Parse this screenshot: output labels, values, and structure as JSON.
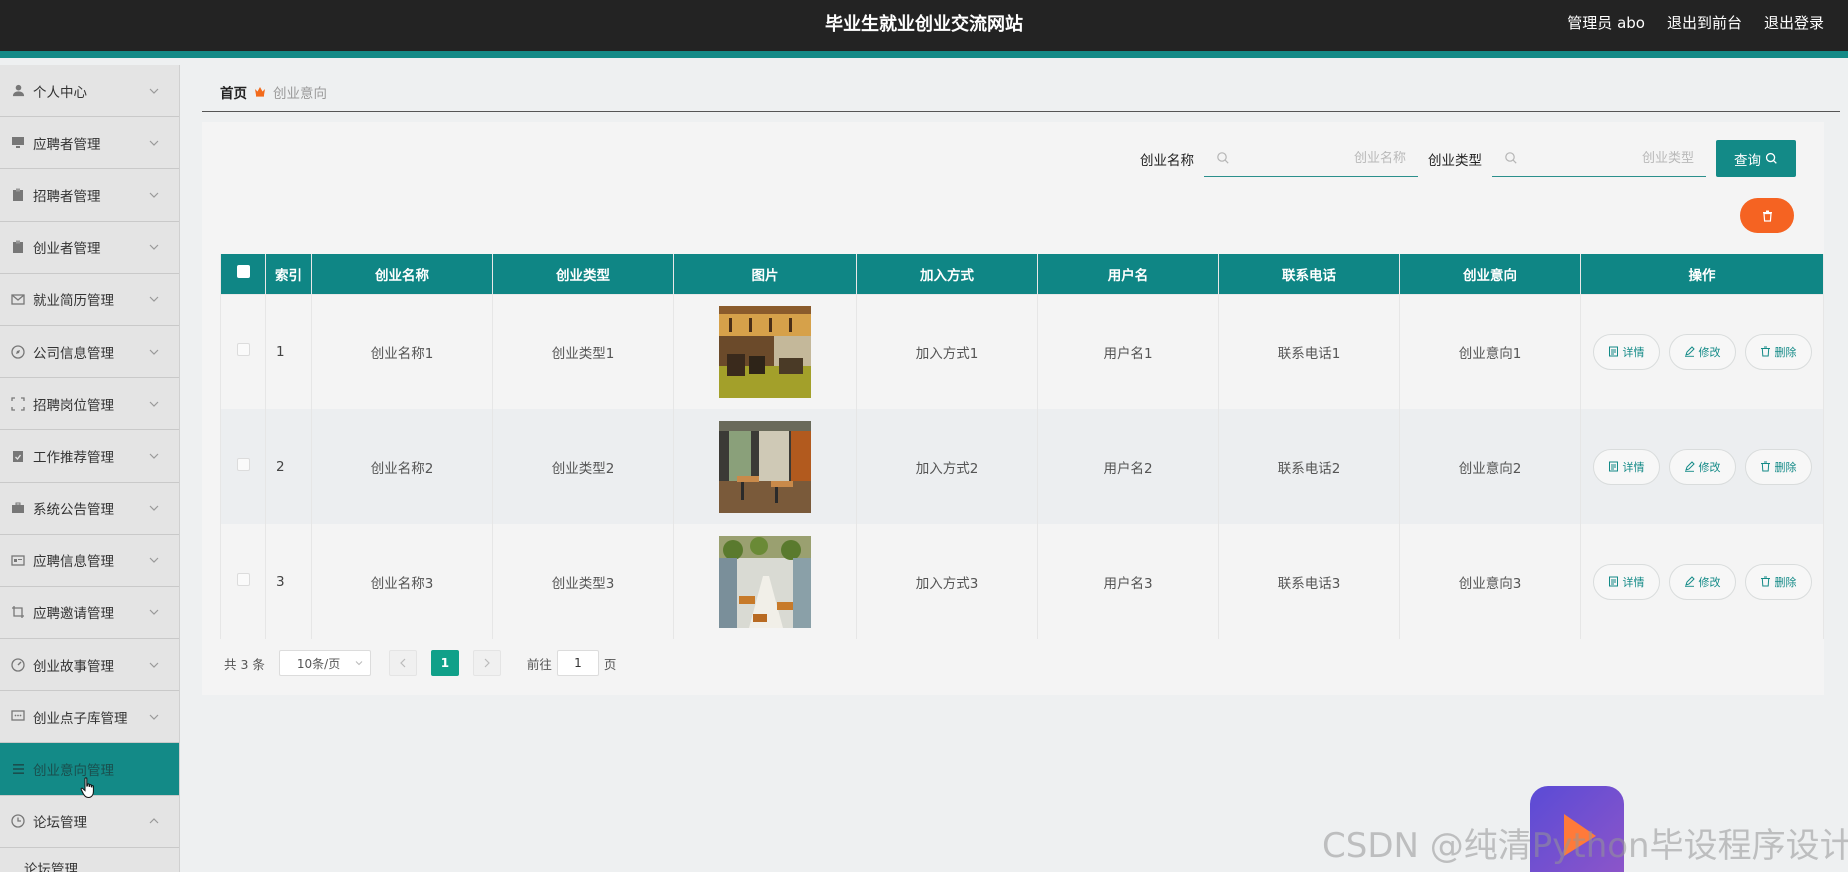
{
  "header": {
    "title": "毕业生就业创业交流网站",
    "admin": "管理员 abo",
    "to_front": "退出到前台",
    "logout": "退出登录"
  },
  "sidebar": {
    "items": [
      {
        "label": "个人中心",
        "icon": "user-icon"
      },
      {
        "label": "应聘者管理",
        "icon": "monitor-icon"
      },
      {
        "label": "招聘者管理",
        "icon": "clipboard-icon"
      },
      {
        "label": "创业者管理",
        "icon": "clipboard-icon"
      },
      {
        "label": "就业简历管理",
        "icon": "mail-icon"
      },
      {
        "label": "公司信息管理",
        "icon": "compass-icon"
      },
      {
        "label": "招聘岗位管理",
        "icon": "scan-icon"
      },
      {
        "label": "工作推荐管理",
        "icon": "checklist-icon"
      },
      {
        "label": "系统公告管理",
        "icon": "briefcase-icon"
      },
      {
        "label": "应聘信息管理",
        "icon": "card-icon"
      },
      {
        "label": "应聘邀请管理",
        "icon": "crop-icon"
      },
      {
        "label": "创业故事管理",
        "icon": "gauge-icon"
      },
      {
        "label": "创业点子库管理",
        "icon": "chat-icon"
      },
      {
        "label": "创业意向管理",
        "icon": "list-icon"
      },
      {
        "label": "论坛管理",
        "icon": "clock-icon"
      }
    ],
    "sub_item": "论坛管理"
  },
  "breadcrumb": {
    "home": "首页",
    "current": "创业意向"
  },
  "search": {
    "name_label": "创业名称",
    "name_placeholder": "创业名称",
    "type_label": "创业类型",
    "type_placeholder": "创业类型",
    "query_label": "查询"
  },
  "table": {
    "headers": [
      "索引",
      "创业名称",
      "创业类型",
      "图片",
      "加入方式",
      "用户名",
      "联系电话",
      "创业意向",
      "操作"
    ],
    "rows": [
      {
        "index": "1",
        "name": "创业名称1",
        "type": "创业类型1",
        "join": "加入方式1",
        "user": "用户名1",
        "phone": "联系电话1",
        "intent": "创业意向1"
      },
      {
        "index": "2",
        "name": "创业名称2",
        "type": "创业类型2",
        "join": "加入方式2",
        "user": "用户名2",
        "phone": "联系电话2",
        "intent": "创业意向2"
      },
      {
        "index": "3",
        "name": "创业名称3",
        "type": "创业类型3",
        "join": "加入方式3",
        "user": "用户名3",
        "phone": "联系电话3",
        "intent": "创业意向3"
      }
    ],
    "actions": {
      "detail": "详情",
      "edit": "修改",
      "delete": "删除"
    }
  },
  "pager": {
    "total": "共 3 条",
    "page_size": "10条/页",
    "current": "1",
    "goto_label": "前往",
    "goto_value": "1",
    "goto_suffix": "页"
  },
  "watermark": "CSDN @纯清Python毕设程序设计",
  "colors": {
    "accent": "#138a87",
    "header_bg": "#232323",
    "danger": "#f56322",
    "page_active": "#10a089"
  }
}
